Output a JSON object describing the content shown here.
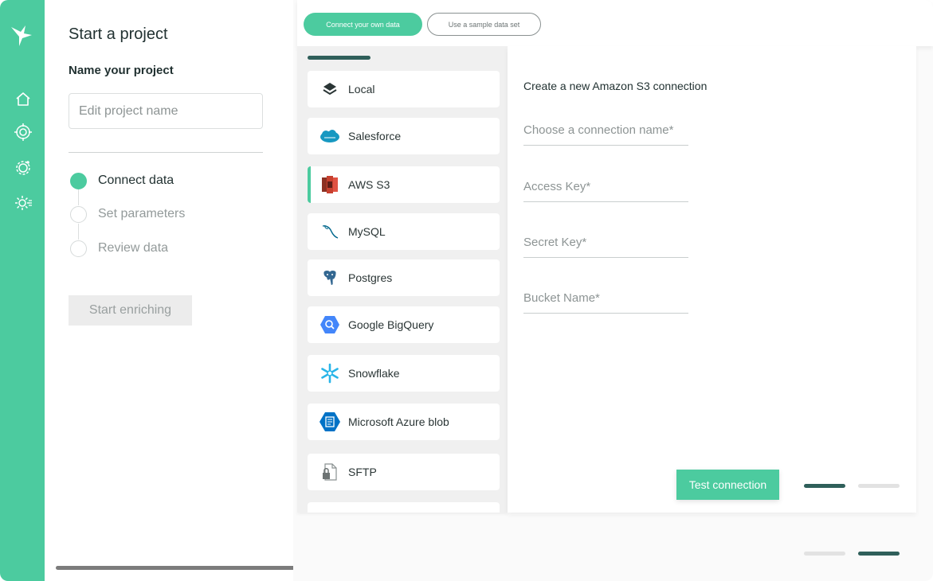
{
  "project": {
    "title": "Start a project",
    "subtitle": "Name your project",
    "name_placeholder": "Edit project name",
    "steps": [
      {
        "label": "Connect data",
        "active": true
      },
      {
        "label": "Set parameters",
        "active": false
      },
      {
        "label": "Review data",
        "active": false
      }
    ],
    "start_button": "Start enriching"
  },
  "topbar": {
    "connect_own_label": "Connect your own data",
    "sample_label": "Use a sample data set"
  },
  "sources": [
    {
      "name": "Local",
      "icon": "layers-icon"
    },
    {
      "name": "Salesforce",
      "icon": "salesforce-icon"
    },
    {
      "name": "AWS S3",
      "icon": "aws-s3-icon",
      "selected": true
    },
    {
      "name": "MySQL",
      "icon": "mysql-icon"
    },
    {
      "name": "Postgres",
      "icon": "postgres-icon"
    },
    {
      "name": "Google BigQuery",
      "icon": "bigquery-icon"
    },
    {
      "name": "Snowflake",
      "icon": "snowflake-icon"
    },
    {
      "name": "Microsoft Azure blob",
      "icon": "azure-blob-icon"
    },
    {
      "name": "SFTP",
      "icon": "sftp-icon"
    }
  ],
  "form": {
    "title": "Create a new Amazon S3 connection",
    "connection_name_placeholder": "Choose a connection name*",
    "access_key_placeholder": "Access Key*",
    "secret_key_placeholder": "Secret Key*",
    "bucket_name_placeholder": "Bucket Name*",
    "test_button": "Test connection"
  },
  "colors": {
    "accent": "#4ccb9f",
    "dark_teal": "#2f5f5a"
  }
}
